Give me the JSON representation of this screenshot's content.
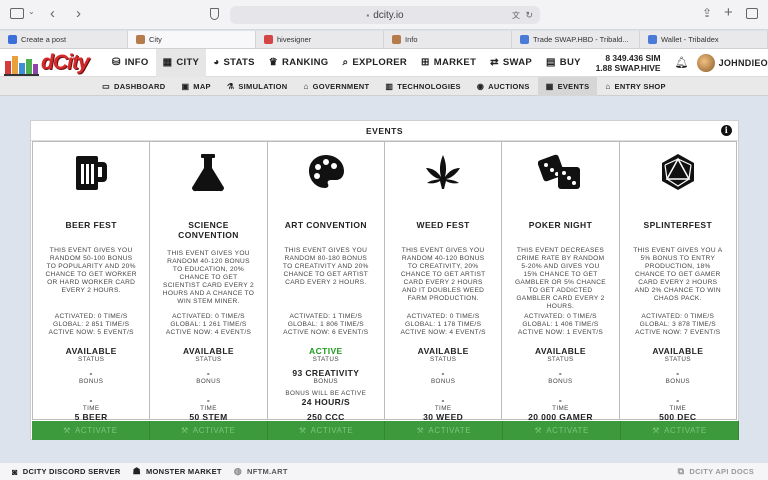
{
  "browser": {
    "url": "dcity.io",
    "tabs": [
      {
        "label": "Create a post",
        "color": "#3b6fd9",
        "active": false
      },
      {
        "label": "City",
        "color": "#b57b4a",
        "active": true
      },
      {
        "label": "hivesigner",
        "color": "#d64545",
        "active": false
      },
      {
        "label": "Info",
        "color": "#b57b4a",
        "active": false
      },
      {
        "label": "Trade SWAP.HBD - Tribald...",
        "color": "#4a7bd6",
        "active": false
      },
      {
        "label": "Wallet - Tribaldex",
        "color": "#4a7bd6",
        "active": false
      }
    ]
  },
  "nav": {
    "logo_text": "dCity",
    "items": [
      {
        "label": "INFO",
        "icon": "coins-icon",
        "glyph": "⛁"
      },
      {
        "label": "CITY",
        "icon": "city-icon",
        "glyph": "▦"
      },
      {
        "label": "STATS",
        "icon": "pie-chart-icon",
        "glyph": "◕"
      },
      {
        "label": "RANKING",
        "icon": "trophy-icon",
        "glyph": "♛"
      },
      {
        "label": "EXPLORER",
        "icon": "search-icon",
        "glyph": "⌕"
      },
      {
        "label": "MARKET",
        "icon": "cart-icon",
        "glyph": "⊞"
      },
      {
        "label": "SWAP",
        "icon": "swap-icon",
        "glyph": "⇄"
      },
      {
        "label": "BUY",
        "icon": "money-icon",
        "glyph": "▤"
      }
    ],
    "balance_sim": "8 349.436 SIM",
    "balance_swap": "1.88 SWAP.HIVE",
    "username": "JOHNDIEO"
  },
  "subnav": [
    {
      "label": "DASHBOARD",
      "glyph": "▭"
    },
    {
      "label": "MAP",
      "glyph": "▣"
    },
    {
      "label": "SIMULATION",
      "glyph": "⚗"
    },
    {
      "label": "GOVERNMENT",
      "glyph": "⌂"
    },
    {
      "label": "TECHNOLOGIES",
      "glyph": "▥"
    },
    {
      "label": "AUCTIONS",
      "glyph": "◉"
    },
    {
      "label": "EVENTS",
      "glyph": "▦"
    },
    {
      "label": "ENTRY SHOP",
      "glyph": "⌂"
    }
  ],
  "events_panel": {
    "title": "EVENTS",
    "activate_label": "ACTIVATE",
    "events": [
      {
        "icon": "beer-mug-icon",
        "name_l1": "BEER FEST",
        "name_l2": "",
        "desc": [
          "THIS EVENT GIVES YOU",
          "RANDOM 50-100 BONUS",
          "TO POPULARITY AND 20%",
          "CHANCE TO GET WORKER",
          "OR HARD WORKER CARD",
          "EVERY 2 HOURS."
        ],
        "activated": "ACTIVATED: 0 TIME/S",
        "global": "GLOBAL: 2 851 TIME/S",
        "active_now": "ACTIVE NOW: 5 EVENT/S",
        "status": "AVAILABLE",
        "status_label": "STATUS",
        "bonus": "-",
        "bonus_label": "BONUS",
        "time": "-",
        "time_label": "TIME",
        "cost": "5 BEER",
        "cost_label": "COST",
        "active": false
      },
      {
        "icon": "flask-icon",
        "name_l1": "SCIENCE",
        "name_l2": "CONVENTION",
        "desc": [
          "THIS EVENT GIVES YOU",
          "RANDOM 40-120 BONUS",
          "TO EDUCATION, 20%",
          "CHANCE TO GET",
          "SCIENTIST CARD EVERY 2",
          "HOURS AND A CHANCE TO",
          "WIN STEM MINER."
        ],
        "activated": "ACTIVATED: 0 TIME/S",
        "global": "GLOBAL: 1 261 TIME/S",
        "active_now": "ACTIVE NOW: 4 EVENT/S",
        "status": "AVAILABLE",
        "status_label": "STATUS",
        "bonus": "-",
        "bonus_label": "BONUS",
        "time": "-",
        "time_label": "TIME",
        "cost": "50 STEM",
        "cost_label": "COST",
        "active": false
      },
      {
        "icon": "palette-icon",
        "name_l1": "ART CONVENTION",
        "name_l2": "",
        "desc": [
          "THIS EVENT GIVES YOU",
          "RANDOM 80-180 BONUS",
          "TO CREATIVITY AND 20%",
          "CHANCE TO GET ARTIST",
          "CARD EVERY 2 HOURS."
        ],
        "activated": "ACTIVATED: 1 TIME/S",
        "global": "GLOBAL: 1 806 TIME/S",
        "active_now": "ACTIVE NOW: 6 EVENT/S",
        "status": "ACTIVE",
        "status_label": "STATUS",
        "bonus": "93 CREATIVITY",
        "bonus_label": "BONUS",
        "time_note": "BONUS WILL BE ACTIVE",
        "time": "24 HOUR/S",
        "time_label": "",
        "cost": "250 CCC",
        "cost_label": "COST",
        "active": true
      },
      {
        "icon": "cannabis-leaf-icon",
        "name_l1": "WEED FEST",
        "name_l2": "",
        "desc": [
          "THIS EVENT GIVES YOU",
          "RANDOM 40-120 BONUS",
          "TO CREATIVITY, 20%",
          "CHANCE TO GET ARTIST",
          "CARD EVERY 2 HOURS",
          "AND IT DOUBLES WEED",
          "FARM PRODUCTION."
        ],
        "activated": "ACTIVATED: 0 TIME/S",
        "global": "GLOBAL: 1 178 TIME/S",
        "active_now": "ACTIVE NOW: 4 EVENT/S",
        "status": "AVAILABLE",
        "status_label": "STATUS",
        "bonus": "-",
        "bonus_label": "BONUS",
        "time": "-",
        "time_label": "TIME",
        "cost": "30 WEED",
        "cost_label": "COST",
        "active": false
      },
      {
        "icon": "dice-icon",
        "name_l1": "POKER NIGHT",
        "name_l2": "",
        "desc": [
          "THIS EVENT DECREASES",
          "CRIME RATE BY RANDOM",
          "5-20% AND GIVES YOU",
          "15% CHANCE TO GET",
          "GAMBLER OR 5% CHANCE",
          "TO GET ADDICTED",
          "GAMBLER CARD EVERY 2",
          "HOURS."
        ],
        "activated": "ACTIVATED: 0 TIME/S",
        "global": "GLOBAL: 1 406 TIME/S",
        "active_now": "ACTIVE NOW: 1 EVENT/S",
        "status": "AVAILABLE",
        "status_label": "STATUS",
        "bonus": "-",
        "bonus_label": "BONUS",
        "time": "-",
        "time_label": "TIME",
        "cost": "20 000 GAMER",
        "cost_label": "COST",
        "active": false
      },
      {
        "icon": "d20-icon",
        "name_l1": "SPLINTERFEST",
        "name_l2": "",
        "desc": [
          "THIS EVENT GIVES YOU A",
          "5% BONUS TO ENTRY",
          "PRODUCTION, 18%",
          "CHANCE TO GET GAMER",
          "CARD EVERY 2 HOURS",
          "AND 2% CHANCE TO WIN",
          "CHAOS PACK."
        ],
        "activated": "ACTIVATED: 0 TIME/S",
        "global": "GLOBAL: 3 878 TIME/S",
        "active_now": "ACTIVE NOW: 7 EVENT/S",
        "status": "AVAILABLE",
        "status_label": "STATUS",
        "bonus": "-",
        "bonus_label": "BONUS",
        "time": "-",
        "time_label": "TIME",
        "cost": "500 DEC",
        "cost_label": "COST",
        "active": false
      }
    ]
  },
  "footer": {
    "discord": "DCITY DISCORD SERVER",
    "monster": "MONSTER MARKET",
    "nftm": "NFTM.ART",
    "api": "DCITY API DOCS"
  },
  "colors": {
    "active_green": "#1d9b1d",
    "activate_bar": "#3c9a3c",
    "page_bg": "#dce3ec"
  }
}
